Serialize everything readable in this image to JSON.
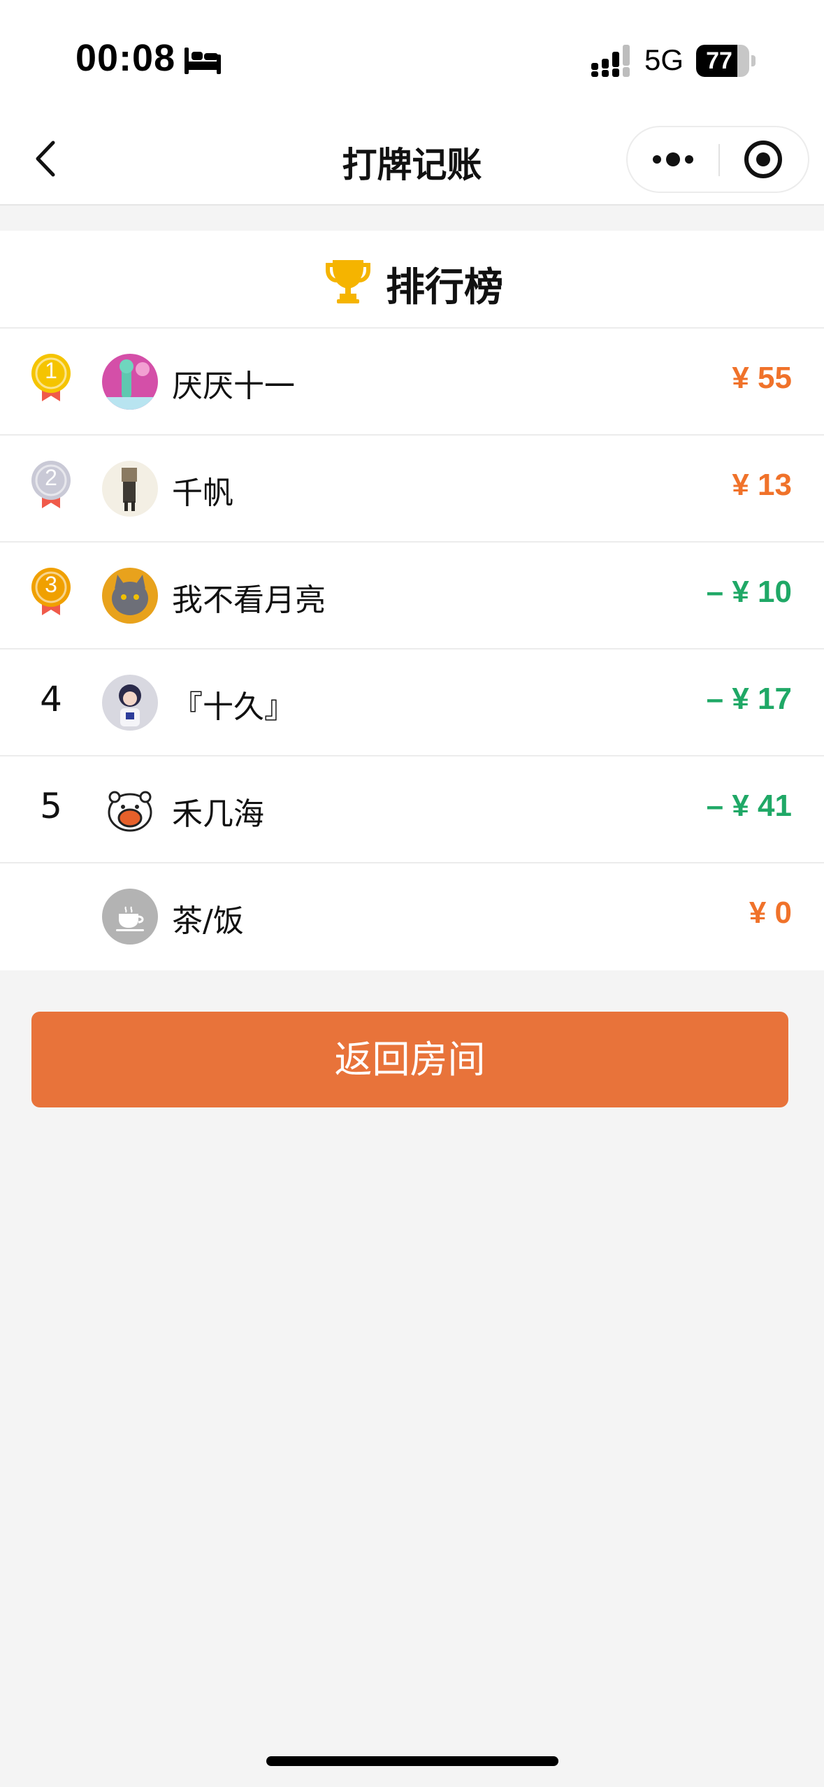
{
  "status_bar": {
    "time": "00:08",
    "network": "5G",
    "battery_level": 77,
    "battery_text": "77",
    "focus_icon": "bed-icon",
    "signal_icon": "signal-icon"
  },
  "nav": {
    "title": "打牌记账",
    "back_icon": "chevron-left-icon",
    "more_icon": "more-dots-icon",
    "close_icon": "target-icon"
  },
  "leaderboard": {
    "title": "排行榜",
    "icon": "trophy-icon",
    "rows": [
      {
        "rank": "1",
        "medal": "gold",
        "name": "厌厌十一",
        "amount": "¥ 55",
        "type": "positive",
        "avatar": "pink-avatar"
      },
      {
        "rank": "2",
        "medal": "silver",
        "name": "千帆",
        "amount": "¥ 13",
        "type": "positive",
        "avatar": "figure-avatar"
      },
      {
        "rank": "3",
        "medal": "bronze",
        "name": "我不看月亮",
        "amount": "– ¥ 10",
        "type": "negative",
        "avatar": "cat-avatar"
      },
      {
        "rank": "4",
        "medal": "",
        "name": "『十久』",
        "amount": "– ¥ 17",
        "type": "negative",
        "avatar": "girl-avatar"
      },
      {
        "rank": "5",
        "medal": "",
        "name": "禾几海",
        "amount": "– ¥ 41",
        "type": "negative",
        "avatar": "bear-avatar"
      },
      {
        "rank": "",
        "medal": "",
        "name": "茶/饭",
        "amount": "¥ 0",
        "type": "positive",
        "avatar": "tea-cup-icon"
      }
    ]
  },
  "actions": {
    "return_label": "返回房间"
  },
  "colors": {
    "accent": "#e8733a",
    "positive": "#f0722a",
    "negative": "#1fa866",
    "gold": "#f5c400",
    "silver": "#c9c9d6",
    "bronze": "#f0a000",
    "ribbon": "#f05a4a"
  }
}
